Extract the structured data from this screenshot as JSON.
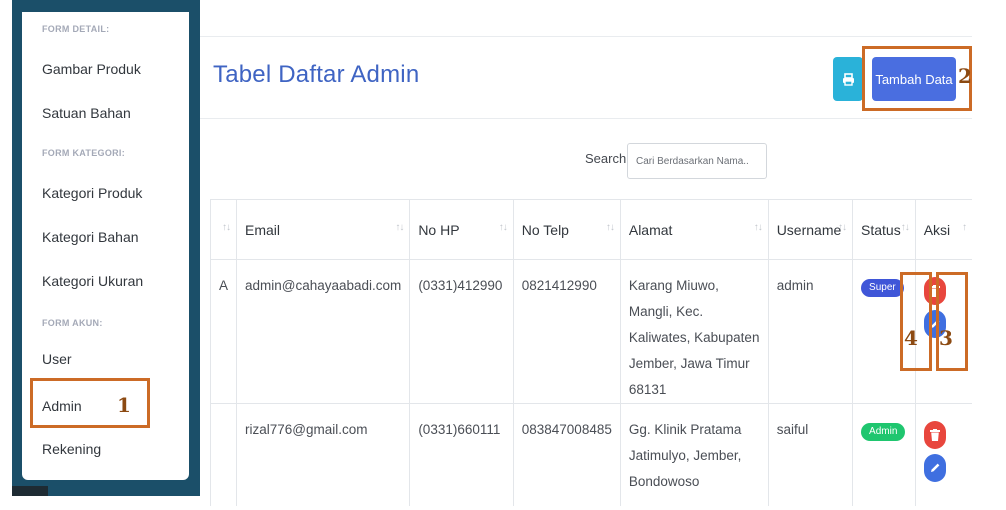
{
  "sidebar": {
    "form_detail_heading": "FORM DETAIL:",
    "gambar_produk": "Gambar Produk",
    "satuan_bahan": "Satuan Bahan",
    "form_kategori_heading": "FORM KATEGORI:",
    "kategori_produk": "Kategori Produk",
    "kategori_bahan": "Kategori Bahan",
    "kategori_ukuran": "Kategori Ukuran",
    "form_akun_heading": "FORM AKUN:",
    "user": "User",
    "admin": "Admin",
    "rekening": "Rekening"
  },
  "header": {
    "title": "Tabel Daftar Admin",
    "print_icon": "printer-icon",
    "add_label": "Tambah Data"
  },
  "search": {
    "label": "Search:",
    "placeholder": "Cari Berdasarkan Nama.."
  },
  "table": {
    "columns": [
      "",
      "Email",
      "No HP",
      "No Telp",
      "Alamat",
      "Username",
      "Status",
      "Aksi"
    ],
    "rows": [
      {
        "col0": "A",
        "email": "admin@cahayaabadi.com",
        "no_hp": "(0331)412990",
        "no_telp": "0821412990",
        "alamat": "Karang Miuwo, Mangli, Kec. Kaliwates, Kabupaten Jember, Jawa Timur 68131",
        "username": "admin",
        "status": "Super"
      },
      {
        "col0": "",
        "email": "rizal776@gmail.com",
        "no_hp": "(0331)660111",
        "no_telp": "083847008485",
        "alamat": "Gg. Klinik Pratama Jatimulyo, Jember, Bondowoso",
        "username": "saiful",
        "status": "Admin"
      }
    ]
  },
  "annotations": [
    "1",
    "2",
    "3",
    "4"
  ],
  "colors": {
    "accent": "#4a6ee0",
    "title": "#3f64c3",
    "sidebar_dark": "#1b4f69",
    "annotation": "#cc6b26",
    "badge_super": "#3f56d8",
    "badge_admin": "#1fc66f",
    "delete": "#e8463d",
    "edit": "#3f6fe0"
  }
}
